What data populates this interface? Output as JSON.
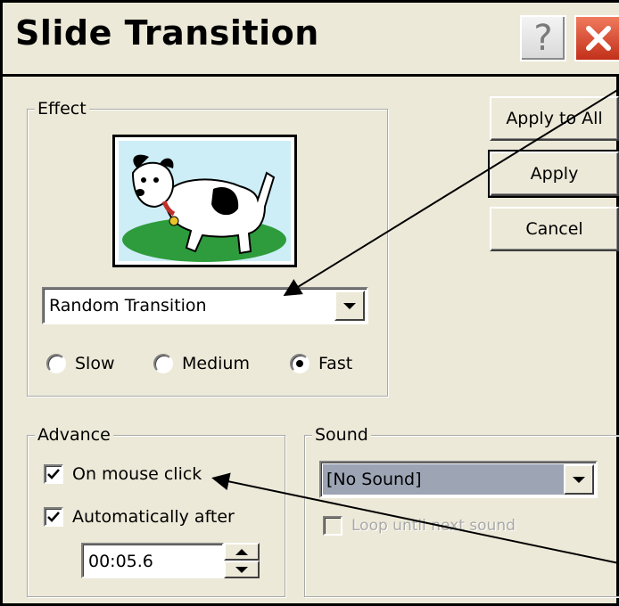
{
  "window": {
    "title": "Slide Transition"
  },
  "effect": {
    "group_label": "Effect",
    "transition": "Random Transition",
    "speeds": [
      {
        "label": "Slow",
        "selected": false
      },
      {
        "label": "Medium",
        "selected": false
      },
      {
        "label": "Fast",
        "selected": true
      }
    ]
  },
  "buttons": {
    "apply_all": "Apply to All",
    "apply": "Apply",
    "cancel": "Cancel"
  },
  "advance": {
    "group_label": "Advance",
    "on_mouse_click": {
      "label": "On mouse click",
      "checked": true
    },
    "automatically": {
      "label": "Automatically after",
      "checked": true
    },
    "time": "00:05.6"
  },
  "sound": {
    "group_label": "Sound",
    "selection": "[No Sound]",
    "loop": {
      "label": "Loop until next sound",
      "checked": false,
      "enabled": false
    }
  },
  "icons": [
    "help-icon",
    "close-icon",
    "dropdown-arrow-icon",
    "spin-up-icon",
    "spin-down-icon",
    "checkmark-icon"
  ],
  "colors": {
    "background": "#ece9d8",
    "close_button": "#d9472b",
    "sound_selected": "#9da5b5"
  }
}
